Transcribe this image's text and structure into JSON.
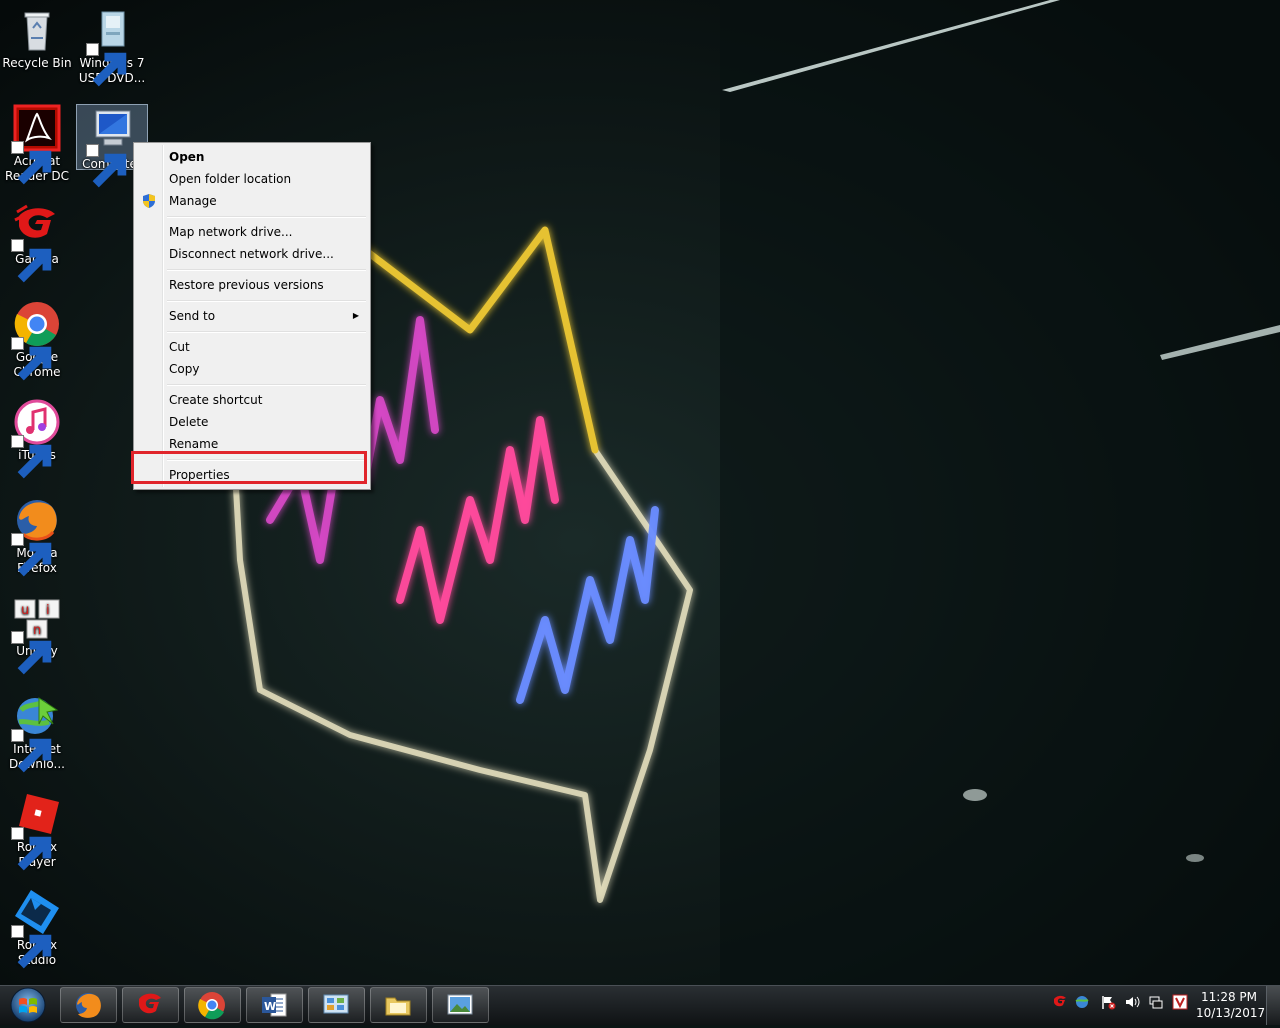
{
  "desktop": {
    "icons": [
      {
        "label": "Recycle Bin",
        "icon": "recycle-bin-icon"
      },
      {
        "label": "Windows 7\nUSB DVD...",
        "icon": "usb-dvd-tool-icon"
      },
      {
        "label": "Acrobat\nReader DC",
        "icon": "acrobat-reader-icon"
      },
      {
        "label": "Computer",
        "icon": "computer-icon"
      },
      {
        "label": "Garena",
        "icon": "garena-icon"
      },
      {
        "label": "Google\nChrome",
        "icon": "chrome-icon"
      },
      {
        "label": "iTunes",
        "icon": "itunes-icon"
      },
      {
        "label": "Mozilla\nFirefox",
        "icon": "firefox-icon"
      },
      {
        "label": "UniKey",
        "icon": "unikey-icon"
      },
      {
        "label": "Internet\nDownlo...",
        "icon": "internet-download-manager-icon"
      },
      {
        "label": "Roblox Player",
        "icon": "roblox-player-icon"
      },
      {
        "label": "Roblox\nStudio",
        "icon": "roblox-studio-icon"
      }
    ]
  },
  "context_menu": {
    "items": [
      {
        "label": "Open",
        "bold": true
      },
      {
        "label": "Open folder location"
      },
      {
        "label": "Manage",
        "icon": "uac-shield-icon"
      },
      {
        "label": "Map network drive..."
      },
      {
        "label": "Disconnect network drive..."
      },
      {
        "label": "Restore previous versions"
      },
      {
        "label": "Send to",
        "submenu": true
      },
      {
        "label": "Cut"
      },
      {
        "label": "Copy"
      },
      {
        "label": "Create shortcut"
      },
      {
        "label": "Delete"
      },
      {
        "label": "Rename"
      },
      {
        "label": "Properties"
      }
    ],
    "highlighted": "Properties",
    "highlight_color": "#e0252b"
  },
  "taskbar": {
    "start_icon": "windows-start-orb-icon",
    "pinned": [
      "firefox-icon",
      "garena-icon",
      "chrome-icon",
      "word-icon",
      "control-panel-icon",
      "file-explorer-icon",
      "photo-viewer-icon"
    ],
    "tray_icons": [
      "garena-tray-icon",
      "network-sync-icon",
      "action-center-flag-icon",
      "volume-icon",
      "network-icon",
      "v-app-icon"
    ],
    "clock": {
      "time": "11:28 PM",
      "date": "10/13/2017"
    }
  }
}
